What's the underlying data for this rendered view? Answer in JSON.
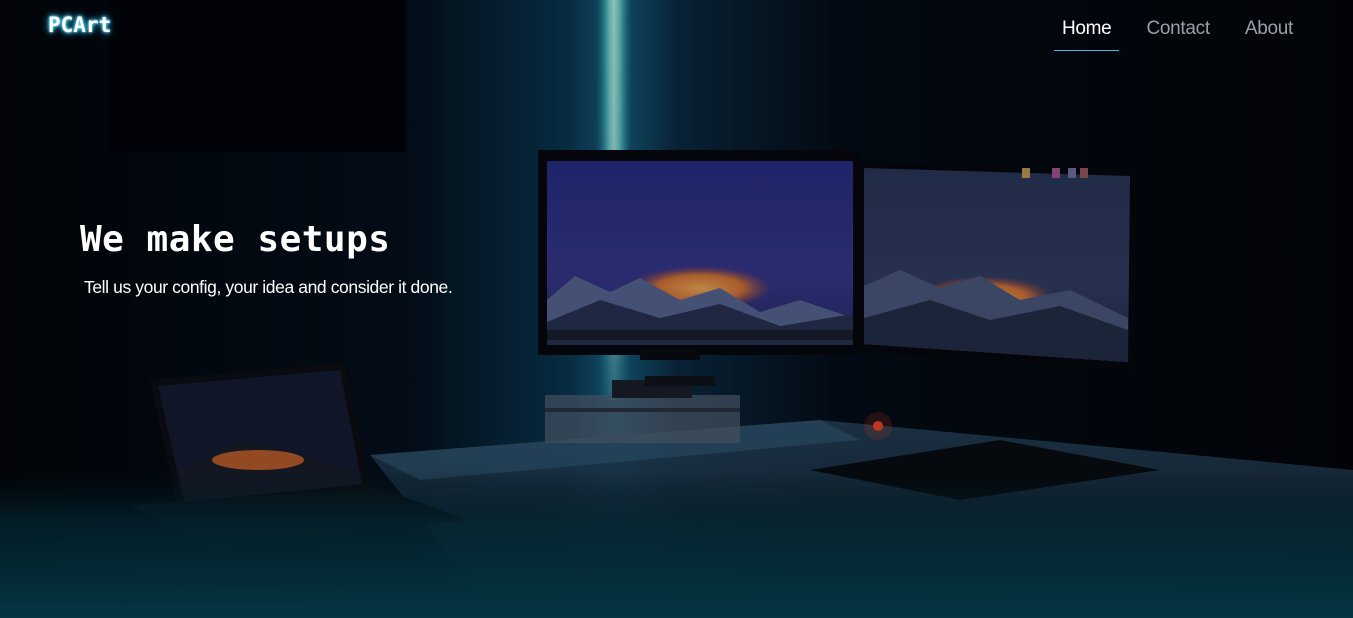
{
  "header": {
    "logo": "PCArt",
    "nav": [
      {
        "label": "Home",
        "active": true
      },
      {
        "label": "Contact",
        "active": false
      },
      {
        "label": "About",
        "active": false
      }
    ]
  },
  "hero": {
    "title": "We make setups",
    "subtitle": "Tell us your config, your idea and consider it done."
  },
  "background": {
    "description_icon": "pc-setup-photo",
    "accent": "#3fb7d6"
  }
}
